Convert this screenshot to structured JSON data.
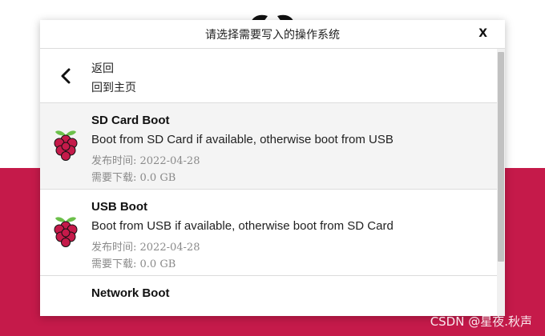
{
  "dialog": {
    "title": "请选择需要写入的操作系统",
    "close_label": "X"
  },
  "back_item": {
    "title": "返回",
    "subtitle": "回到主页"
  },
  "items": [
    {
      "name": "SD Card Boot",
      "description": "Boot from SD Card if available, otherwise boot from USB",
      "release": "发布时间: 2022-04-28",
      "download": "需要下载: 0.0 GB",
      "icon": "raspberry-icon"
    },
    {
      "name": "USB Boot",
      "description": "Boot from USB if available, otherwise boot from SD Card",
      "release": "发布时间: 2022-04-28",
      "download": "需要下载: 0.0 GB",
      "icon": "raspberry-icon"
    },
    {
      "name": "Network Boot",
      "icon": "raspberry-icon"
    }
  ],
  "watermark": "CSDN @星夜.秋声",
  "colors": {
    "brand": "#c51a4a",
    "selected_row": "#f4f4f4",
    "raspberry_red": "#c51a4a",
    "leaf_green": "#6cc04a"
  }
}
